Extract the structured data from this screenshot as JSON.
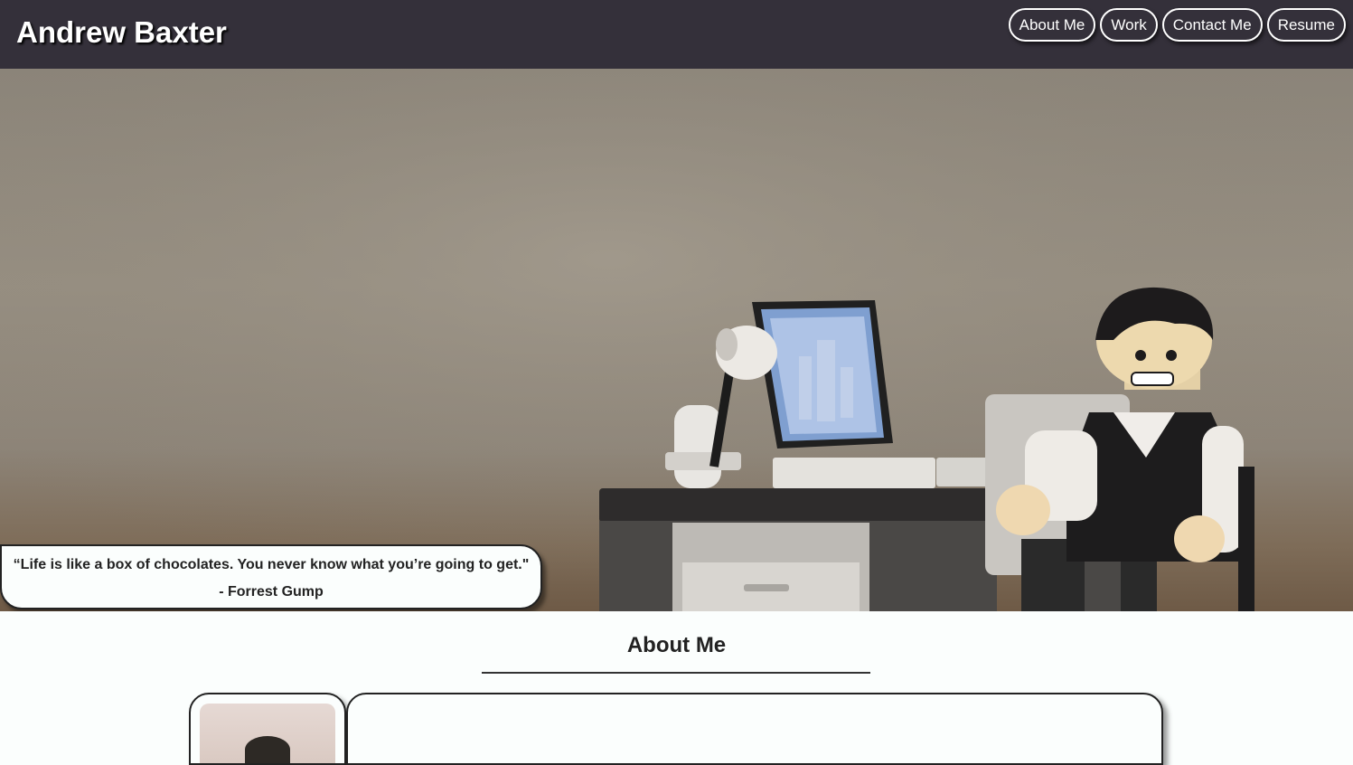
{
  "header": {
    "title": "Andrew Baxter",
    "nav": [
      "About Me",
      "Work",
      "Contact Me",
      "Resume"
    ]
  },
  "hero": {
    "quote": "“Life is like a box of chocolates. You never know what you’re going to get.\"",
    "author": "- Forrest Gump"
  },
  "about": {
    "heading": "About Me"
  },
  "colors": {
    "header_bg": "#34303a",
    "page_bg": "#fbfefd",
    "text": "#222222"
  }
}
